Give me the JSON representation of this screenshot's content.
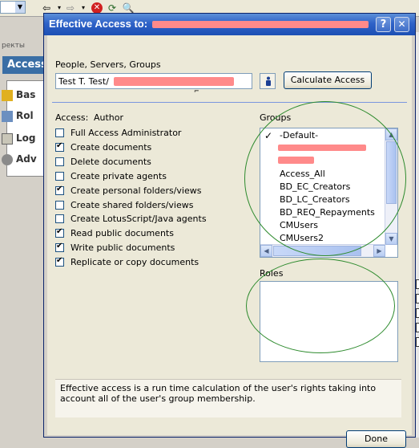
{
  "background": {
    "sidebar_title": "Access",
    "sidebar_tab_fragment": "ректы",
    "nav_items": [
      {
        "label": "Bas"
      },
      {
        "label": "Rol"
      },
      {
        "label": "Log"
      },
      {
        "label": "Adv"
      }
    ]
  },
  "dialog": {
    "title": "Effective Access to:",
    "help_button": "?",
    "close_button": "✕",
    "people_label": "People, Servers, Groups",
    "people_value": "Test T. Test/",
    "calculate_button": "Calculate Access",
    "access_heading": "Access:",
    "access_level": "Author",
    "groups_heading": "Groups",
    "roles_heading": "Roles",
    "permissions": [
      {
        "label": "Full Access Administrator",
        "checked": false
      },
      {
        "label": "Create documents",
        "checked": true
      },
      {
        "label": "Delete documents",
        "checked": false
      },
      {
        "label": "Create private agents",
        "checked": false
      },
      {
        "label": "Create personal folders/views",
        "checked": true
      },
      {
        "label": "Create shared folders/views",
        "checked": false
      },
      {
        "label": "Create LotusScript/Java agents",
        "checked": false
      },
      {
        "label": "Read public documents",
        "checked": true
      },
      {
        "label": "Write public documents",
        "checked": true
      },
      {
        "label": "Replicate or copy documents",
        "checked": true
      }
    ],
    "groups": [
      "-Default-",
      "",
      "",
      "Access_All",
      "BD_EC_Creators",
      "BD_LC_Creators",
      "BD_REQ_Repayments",
      "CMUsers",
      "CMUsers2"
    ],
    "note": "Effective access is a run time calculation of the user's rights taking into account all of the user's group membership.",
    "done_button": "Done"
  },
  "colors": {
    "titlebar": "#2f62c8",
    "dialog_bg": "#ece9d8",
    "redaction": "#ff8a8a",
    "annotation_circle": "#2e8b2e"
  }
}
